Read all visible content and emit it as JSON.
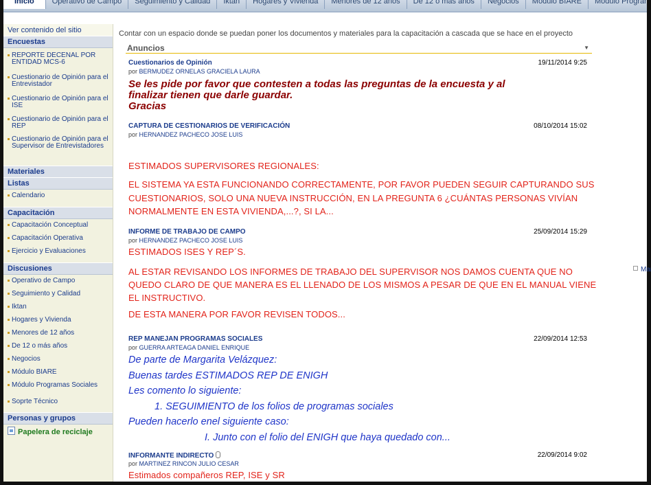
{
  "tabs": [
    "Inicio",
    "Operativo de Campo",
    "Seguimiento y Calidad",
    "Iktan",
    "Hogares y Vivienda",
    "Menores de 12 años",
    "De 12 o más años",
    "Negocios",
    "Módulo BIARE",
    "Módulo Programas Sociales"
  ],
  "sidebar": {
    "view_all": "Ver contenido del sitio",
    "sections": [
      {
        "header": "Encuestas",
        "items": [
          "REPORTE DECENAL POR ENTIDAD MCS-6",
          "Cuestionario de Opinión para el Entrevistador",
          "Cuestionario de Opinión para el ISE",
          "Cuestionario de Opinión para el REP",
          "Cuestionario de Opinión para el Supervisor de Entrevistadores"
        ]
      },
      {
        "header": "Materiales",
        "items": []
      },
      {
        "header": "Listas",
        "items": [
          "Calendario"
        ]
      },
      {
        "header": "Capacitación",
        "items": [
          "Capacitación Conceptual",
          "Capacitación Operativa",
          "Ejercicio y Evaluaciones"
        ]
      },
      {
        "header": "Discusiones",
        "items": [
          "Operativo de Campo",
          "Seguimiento y Calidad",
          "Iktan",
          "Hogares y Vivienda",
          "Menores de 12 años",
          "De 12 o más años",
          "Negocios",
          "Módulo BIARE",
          "Módulo Programas Sociales",
          "Soprte Técnico"
        ]
      },
      {
        "header": "Personas y grupos",
        "items": []
      }
    ],
    "recycle": "Papelera de reciclaje"
  },
  "main": {
    "description": "Contar con un espacio donde se puedan poner los documentos y materiales para la capacitación a cascada que se hace en el proyecto",
    "announcements_title": "Anuncios",
    "side_link": "Marco",
    "posts": [
      {
        "title": "Cuestionarios de Opinión",
        "by_prefix": "por",
        "author": "BERMUDEZ ORNELAS GRACIELA LAURA",
        "date": "19/11/2014 9:25",
        "body": [
          "Se les pide por favor que contesten a todas las preguntas de la encuesta y al",
          "finalizar tienen que darle guardar.",
          "Gracias"
        ]
      },
      {
        "title": "CAPTURA DE CESTIONARIOS DE VERIFICACIÓN",
        "by_prefix": "por",
        "author": "HERNANDEZ PACHECO JOSE LUIS",
        "date": "08/10/2014 15:02",
        "body": [
          "ESTIMADOS SUPERVISORES REGIONALES:",
          "EL SISTEMA YA ESTA FUNCIONANDO CORRECTAMENTE, POR FAVOR PUEDEN SEGUIR CAPTURANDO SUS",
          "CUESTIONARIOS, SOLO UNA NUEVA INSTRUCCIÓN, EN LA PREGUNTA 6 ¿CUÁNTAS PERSONAS VIVÍAN",
          "NORMALMENTE EN ESTA VIVIENDA,...?, SI LA..."
        ]
      },
      {
        "title": "INFORME DE TRABAJO DE CAMPO",
        "by_prefix": "por",
        "author": "HERNANDEZ PACHECO JOSE LUIS",
        "date": "25/09/2014 15:29",
        "body": [
          "ESTIMADOS ISES Y REP´S.",
          "AL ESTAR REVISANDO LOS INFORMES DE TRABAJO DEL SUPERVISOR NOS DAMOS CUENTA QUE NO",
          "QUEDO CLARO DE QUE MANERA ES EL LLENADO DE LOS MISMOS A PESAR DE QUE EN EL MANUAL VIENE",
          "EL INSTRUCTIVO.",
          "DE ESTA MANERA POR FAVOR REVISEN TODOS..."
        ]
      },
      {
        "title": "REP MANEJAN PROGRAMAS SOCIALES",
        "by_prefix": "por",
        "author": "GUERRA ARTEAGA DANIEL ENRIQUE",
        "date": "22/09/2014 12:53",
        "body": [
          "De parte de Margarita Velázquez:",
          "Buenas tardes ESTIMADOS REP DE ENIGH",
          "Les comento lo siguiente:",
          "1. SEGUIMIENTO de los folios de programas sociales",
          "Pueden hacerlo enel siguiente caso:",
          "I. Junto con el folio del ENIGH que haya quedado con..."
        ]
      },
      {
        "title": "INFORMANTE INDIRECTO",
        "by_prefix": "por",
        "author": "MARTINEZ RINCON JULIO CESAR",
        "date": "22/09/2014 9:02",
        "body": [
          "Estimados compañeros REP, ISE y SR"
        ]
      }
    ]
  }
}
